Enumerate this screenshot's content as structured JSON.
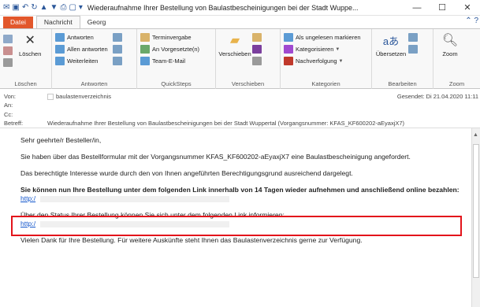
{
  "window": {
    "title": "Wiederaufnahme Ihrer Bestellung von Baulastbescheinigungen bei der Stadt Wuppe...",
    "min_glyph": "—",
    "max_glyph": "☐",
    "close_glyph": "✕"
  },
  "tabs": {
    "file": "Datei",
    "message": "Nachricht",
    "georg": "Georg"
  },
  "ribbon": {
    "delete": {
      "label": "Löschen",
      "delete_button": "Löschen"
    },
    "respond": {
      "label": "Antworten",
      "reply": "Antworten",
      "reply_all": "Allen antworten",
      "forward": "Weiterleiten"
    },
    "quicksteps": {
      "label": "QuickSteps",
      "items": [
        "Terminvergabe",
        "An Vorgesetzte(n)",
        "Team-E-Mail"
      ]
    },
    "move": {
      "label": "Verschieben",
      "move_button": "Verschieben"
    },
    "tags": {
      "label": "Kategorien",
      "items": [
        "Als ungelesen markieren",
        "Kategorisieren",
        "Nachverfolgung"
      ]
    },
    "editing": {
      "label": "Bearbeiten",
      "translate": "Übersetzen"
    },
    "zoom": {
      "label": "Zoom",
      "zoom_button": "Zoom"
    }
  },
  "header": {
    "from_label": "Von:",
    "from_value": "baulastenverzeichnis",
    "to_label": "An:",
    "cc_label": "Cc:",
    "subject_label": "Betreff:",
    "sent": "Gesendet:  Di 21.04.2020 11:11",
    "subject": "Wiederaufnahme Ihrer Bestellung von Baulastbescheinigungen bei der Stadt Wuppertal (Vorgangsnummer: KFAS_KF600202-aEyaxjX7)"
  },
  "body": {
    "greeting": "Sehr geehrte/r Besteller/in,",
    "p1": "Sie haben über das Bestellformular mit der Vorgangsnummer KFAS_KF600202-aEyaxjX7 eine Baulastbescheinigung angefordert.",
    "p2": "Das berechtigte Interesse wurde durch den von Ihnen angeführten Berechtigungsgrund ausreichend dargelegt.",
    "p3": "Sie können nun Ihre Bestellung unter dem folgenden Link innerhalb von 14 Tagen wieder aufnehmen und anschließend online bezahlen:",
    "link1": "http:/",
    "p4": "Über den Status Ihrer Bestellung können Sie sich unter dem folgenden Link informieren:",
    "link2": "http:/",
    "p5": "Vielen Dank für Ihre Bestellung. Für weitere Auskünfte steht Ihnen das Baulastenverzeichnis gerne zur Verfügung."
  },
  "colors": {
    "file_tab": "#e2572b",
    "highlight_border": "#e3141b",
    "link": "#1155cc"
  }
}
